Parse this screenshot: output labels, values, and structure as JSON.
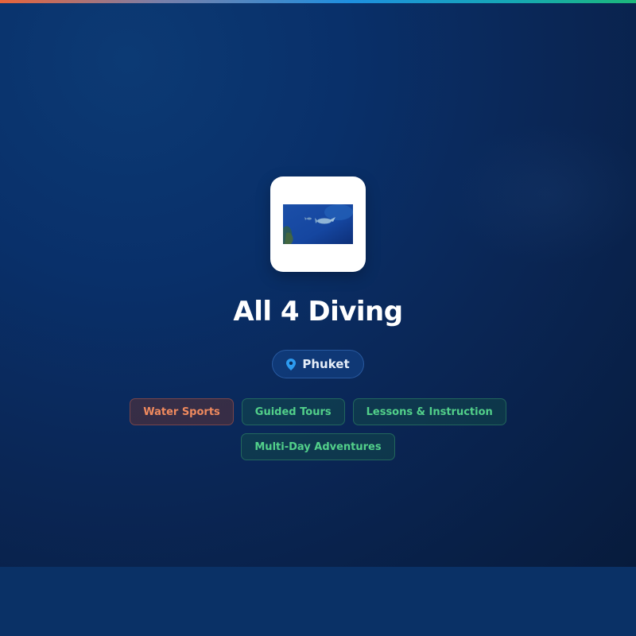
{
  "page": {
    "accent_gradient": [
      "#e8643a",
      "#1e8fe0",
      "#1cb87a"
    ],
    "background": "#0a2450"
  },
  "business": {
    "name": "All 4 Diving",
    "logo_icon": "underwater-diving-photo",
    "location": "Phuket",
    "location_icon": "map-pin-icon"
  },
  "tags": [
    {
      "label": "Water Sports",
      "color": "#f08a5e"
    },
    {
      "label": "Guided Tours",
      "color": "#52d08a"
    },
    {
      "label": "Lessons & Instruction",
      "color": "#52d08a"
    },
    {
      "label": "Multi-Day Adventures",
      "color": "#52d08a"
    }
  ]
}
